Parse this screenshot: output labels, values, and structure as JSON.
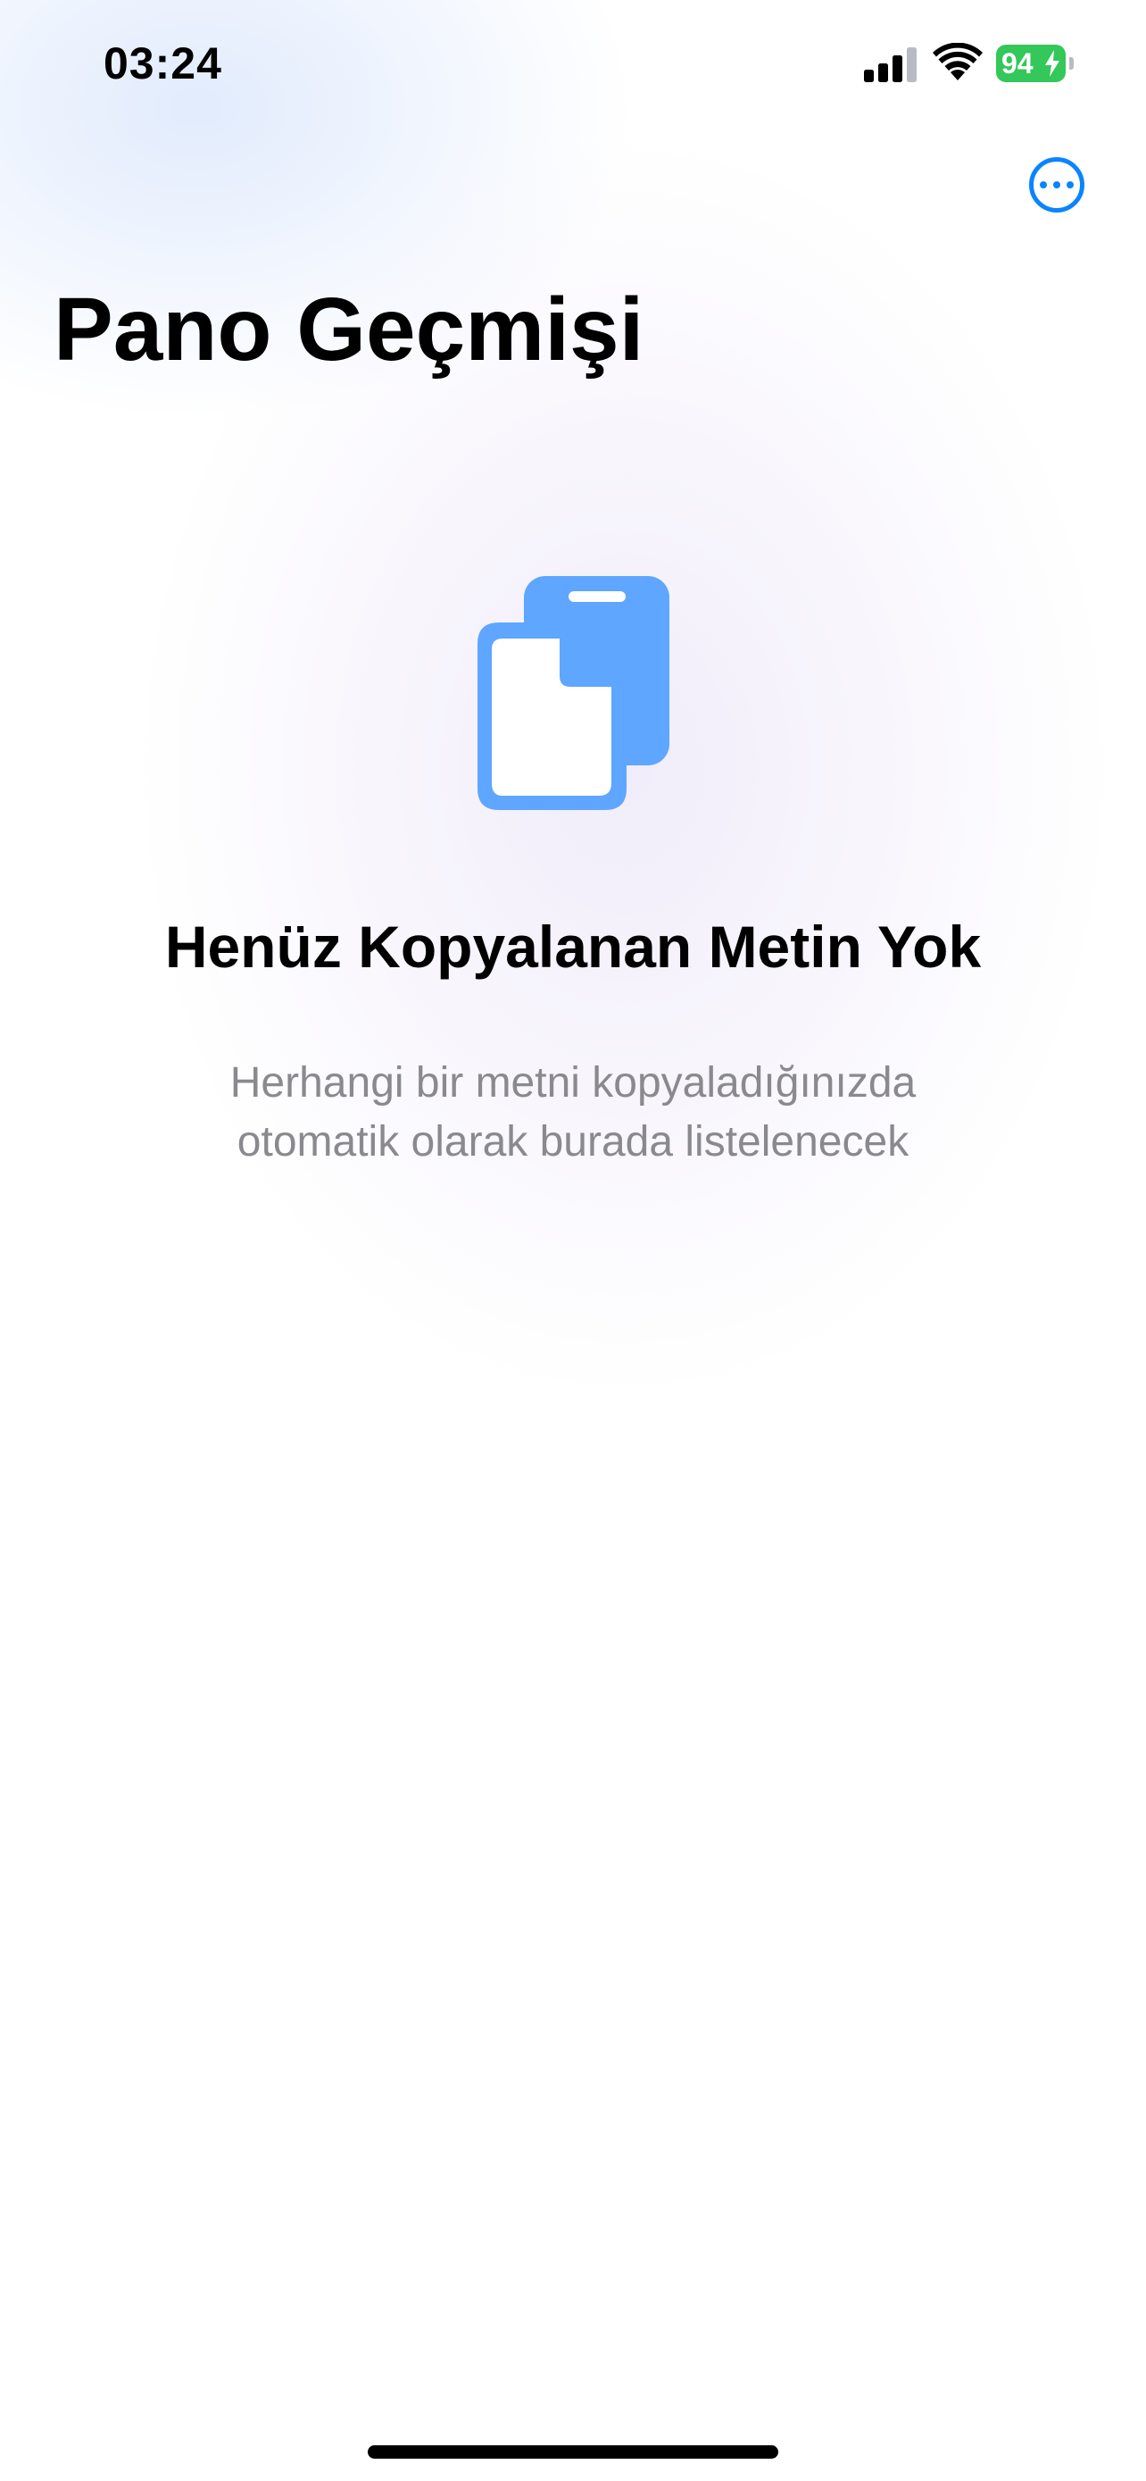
{
  "status_bar": {
    "time": "03:24",
    "battery_level": "94",
    "signal_icon": "cellular-signal-icon",
    "wifi_icon": "wifi-icon",
    "battery_charging": true,
    "battery_color": "#34c759"
  },
  "header": {
    "title": "Pano Geçmişi",
    "more_icon": "ellipsis-circle-icon",
    "accent_color": "#0a84ff"
  },
  "empty_state": {
    "icon": "clipboard-copy-icon",
    "icon_color": "#5ea6ff",
    "title": "Henüz Kopyalanan Metin Yok",
    "description_line1": "Herhangi bir metni kopyaladığınızda",
    "description_line2": "otomatik olarak burada listelenecek"
  }
}
